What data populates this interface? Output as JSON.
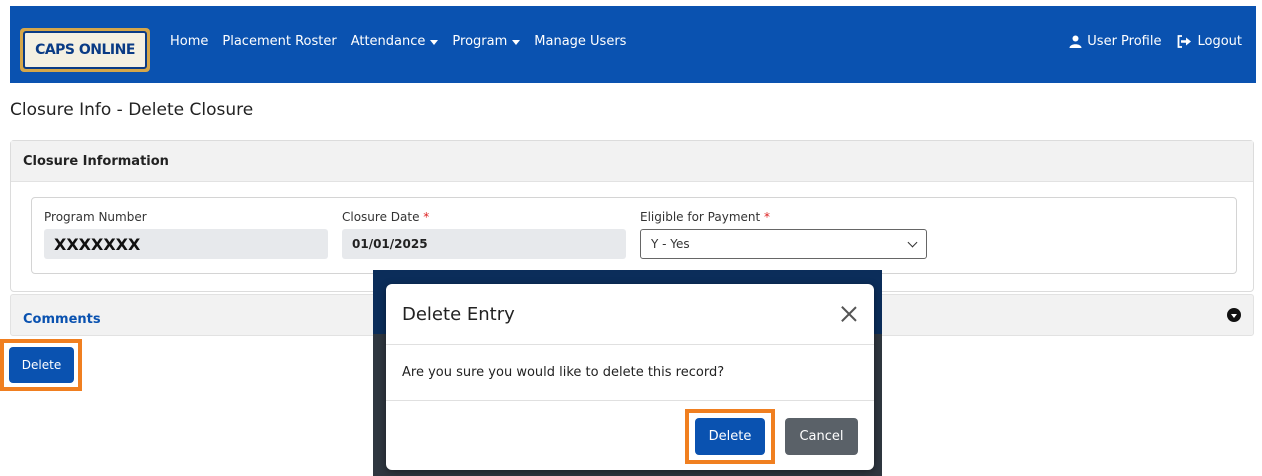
{
  "navbar": {
    "logo_text": "CAPS ONLINE",
    "items": [
      {
        "label": "Home",
        "dropdown": false
      },
      {
        "label": "Placement Roster",
        "dropdown": false
      },
      {
        "label": "Attendance",
        "dropdown": true
      },
      {
        "label": "Program",
        "dropdown": true
      },
      {
        "label": "Manage Users",
        "dropdown": false
      }
    ],
    "user_profile": "User Profile",
    "logout": "Logout",
    "bg_color": "#0a52b0"
  },
  "page": {
    "title": "Closure Info - Delete Closure",
    "card_title": "Closure Information",
    "fields": {
      "program_number": {
        "label": "Program Number",
        "value": "XXXXXXX"
      },
      "closure_date": {
        "label": "Closure Date",
        "required_mark": "*",
        "value": "01/01/2025"
      },
      "eligible_for_payment": {
        "label": "Eligible for Payment",
        "required_mark": "*",
        "value": "Y - Yes"
      }
    },
    "comments_label": "Comments",
    "delete_button": "Delete"
  },
  "modal": {
    "title": "Delete Entry",
    "message": "Are you sure you would like to delete this record?",
    "delete_button": "Delete",
    "cancel_button": "Cancel"
  },
  "colors": {
    "primary": "#0a52b0",
    "highlight": "#f07f20",
    "cancel": "#5a6168"
  }
}
